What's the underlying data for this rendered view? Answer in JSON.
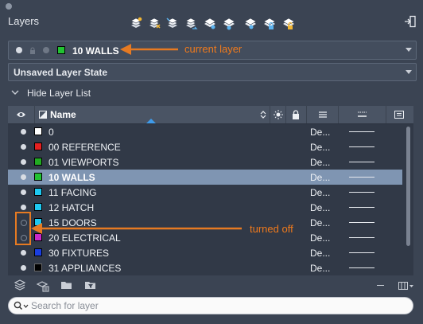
{
  "palette": {
    "orange_annotation": "#e67a22",
    "selected_row": "#7f95b2",
    "panel_bg": "#3b4453"
  },
  "panel": {
    "title": "Layers"
  },
  "toolbar": {
    "icons": [
      "new-layer-icon",
      "new-layer-vp-frozen-icon",
      "layer-match-icon",
      "layer-previous-icon",
      "layer-isolate-icon",
      "layer-unisolate-icon",
      "layer-lock-icon",
      "layer-unlock-icon"
    ]
  },
  "current_layer": {
    "name": "10 WALLS",
    "color": "#22c232"
  },
  "layer_state": {
    "label": "Unsaved Layer State"
  },
  "hide_list": {
    "label": "Hide Layer List"
  },
  "table": {
    "columns": {
      "name": "Name"
    },
    "rows": [
      {
        "name": "0",
        "color": "#ffffff",
        "visible": true,
        "linetype": "De..."
      },
      {
        "name": "00 REFERENCE",
        "color": "#e52020",
        "visible": true,
        "linetype": "De..."
      },
      {
        "name": "01 VIEWPORTS",
        "color": "#22aa22",
        "visible": true,
        "linetype": "De..."
      },
      {
        "name": "10 WALLS",
        "color": "#22c232",
        "visible": true,
        "linetype": "De...",
        "selected": true
      },
      {
        "name": "11 FACING",
        "color": "#1ec8f0",
        "visible": true,
        "linetype": "De..."
      },
      {
        "name": "12 HATCH",
        "color": "#1ec8f0",
        "visible": true,
        "linetype": "De..."
      },
      {
        "name": "15 DOORS",
        "color": "#1ec8f0",
        "visible": false,
        "linetype": "De..."
      },
      {
        "name": "20 ELECTRICAL",
        "color": "#c828c8",
        "visible": false,
        "linetype": "De..."
      },
      {
        "name": "30 FIXTURES",
        "color": "#1a3ee0",
        "visible": true,
        "linetype": "De..."
      },
      {
        "name": "31 APPLIANCES",
        "color": "#000000",
        "visible": true,
        "linetype": "De..."
      }
    ]
  },
  "annotations": {
    "current_layer": "current layer",
    "turned_off": "turned off"
  },
  "search": {
    "placeholder": "Search for layer"
  }
}
